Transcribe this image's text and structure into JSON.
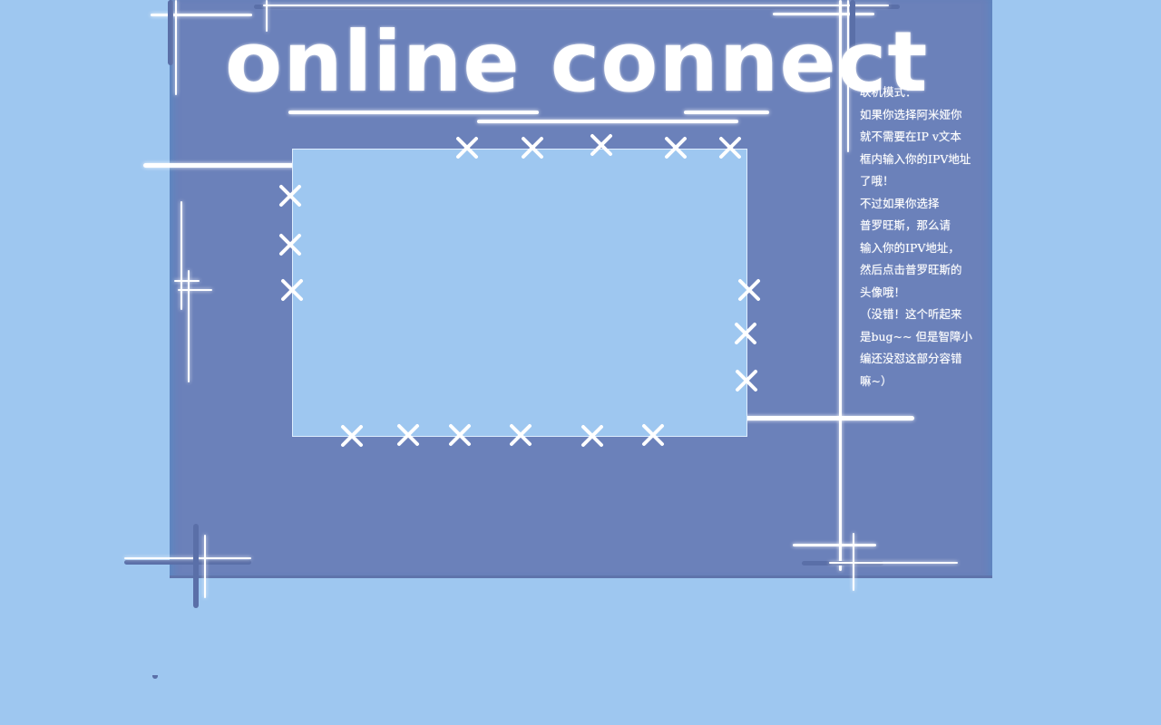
{
  "screen": {
    "title": "online connect",
    "ip_input": {
      "value": "",
      "placeholder": ""
    },
    "info_lines": [
      "联机模式：",
      "如果你选择阿米娅你",
      "就不需要在IP v文本",
      "框内输入你的IPV地址",
      "了哦！",
      "不过如果你选择",
      "普罗旺斯，那么请",
      "输入你的IPV地址，",
      "然后点击普罗旺斯的",
      "头像哦！",
      "（没错！这个听起来",
      "是bug~~ 但是智障小",
      "编还没怼这部分容错",
      "嘛~）"
    ]
  },
  "colors": {
    "background": "#9ec7f0",
    "panel": "#6b81ba",
    "text": "#ffffff",
    "accent_dark": "#5a6fa8"
  },
  "decorations": {
    "stitch_icon": "x-stitch-icon",
    "cross_icon": "crosshair-line-icon"
  }
}
